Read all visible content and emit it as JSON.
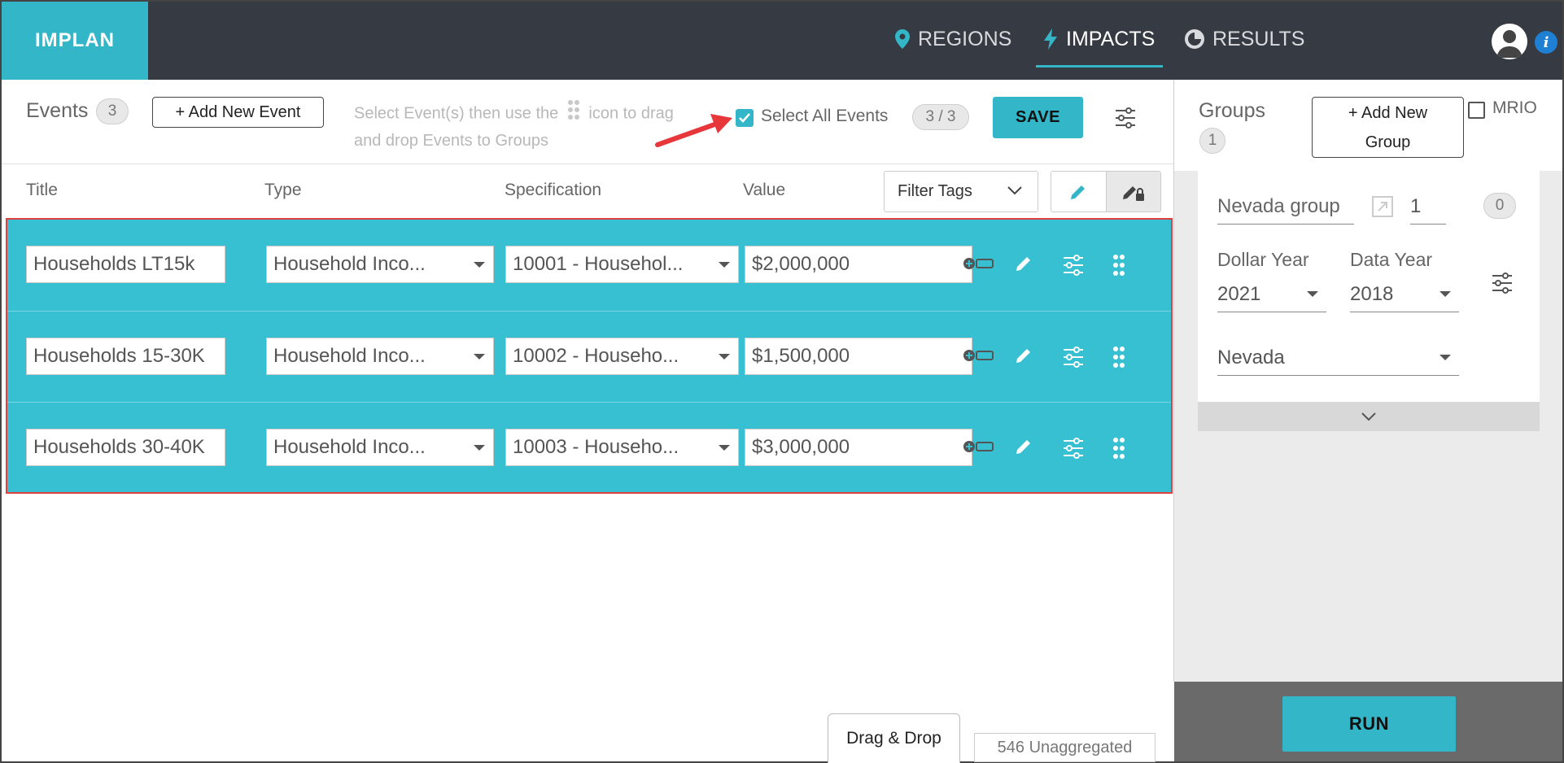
{
  "app": {
    "logo": "IMPLAN"
  },
  "nav": {
    "regions": "REGIONS",
    "impacts": "IMPACTS",
    "results": "RESULTS",
    "active": "impacts"
  },
  "events_toolbar": {
    "label": "Events",
    "count": "3",
    "add_button": "+ Add New Event",
    "hint_before": "Select Event(s) then use the",
    "hint_after": "icon to drag and drop Events to Groups",
    "select_all_label": "Select All Events",
    "select_all_checked": true,
    "selected_count": "3 / 3",
    "save_label": "SAVE"
  },
  "columns": {
    "title": "Title",
    "type": "Type",
    "specification": "Specification",
    "value": "Value",
    "filter_tags": "Filter Tags"
  },
  "events": [
    {
      "title": "Households LT15k",
      "type": "Household Inco...",
      "specification": "10001 - Househol...",
      "value": "$2,000,000"
    },
    {
      "title": "Households 15-30K",
      "type": "Household Inco...",
      "specification": "10002 - Househo...",
      "value": "$1,500,000"
    },
    {
      "title": "Households 30-40K",
      "type": "Household Inco...",
      "specification": "10003 - Househo...",
      "value": "$3,000,000"
    }
  ],
  "footer": {
    "drag_drop": "Drag & Drop",
    "unaggregated": "546 Unaggregated"
  },
  "groups": {
    "label": "Groups",
    "count": "1",
    "add_button_line1": "+ Add New",
    "add_button_line2": "Group",
    "mrio_label": "MRIO",
    "group": {
      "name": "Nevada group",
      "scaling": "1",
      "event_count": "0",
      "dollar_year_label": "Dollar Year",
      "dollar_year": "2021",
      "data_year_label": "Data Year",
      "data_year": "2018",
      "region": "Nevada"
    },
    "run_label": "RUN"
  },
  "colors": {
    "accent": "#34b6c9",
    "header_bg": "#363b43",
    "highlight_border": "#e04040",
    "arrow": "#e8373a"
  }
}
